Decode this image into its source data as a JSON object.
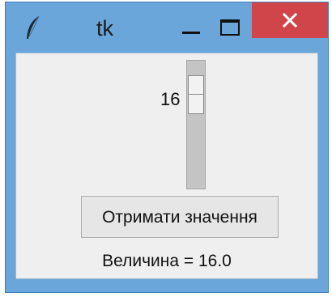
{
  "window": {
    "title": "tk",
    "icons": {
      "app": "feather-icon",
      "minimize": "minimize-icon",
      "maximize": "maximize-icon",
      "close": "close-icon"
    },
    "colors": {
      "titlebar": "#6aa6d9",
      "close_button": "#d0454a",
      "client_bg": "#efefef"
    }
  },
  "scale": {
    "value": "16",
    "level": 0.16,
    "orientation": "vertical"
  },
  "button": {
    "label": "Отримати значення"
  },
  "result": {
    "text": "Величина = 16.0"
  }
}
